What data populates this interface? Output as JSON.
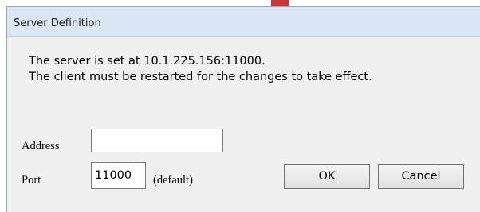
{
  "window": {
    "title": "Server Definition"
  },
  "message": {
    "line1": "The server is set at 10.1.225.156:11000.",
    "line2": "The client must be restarted for the changes to take effect."
  },
  "address": {
    "label": "Address",
    "value": ""
  },
  "port": {
    "label": "Port",
    "value": "11000",
    "hint": "(default)"
  },
  "buttons": {
    "ok": "OK",
    "cancel": "Cancel"
  },
  "colors": {
    "titlebar": "#dbe6f4",
    "dialog_background": "#f0f0f0",
    "top_accent": "#c43a3a"
  }
}
